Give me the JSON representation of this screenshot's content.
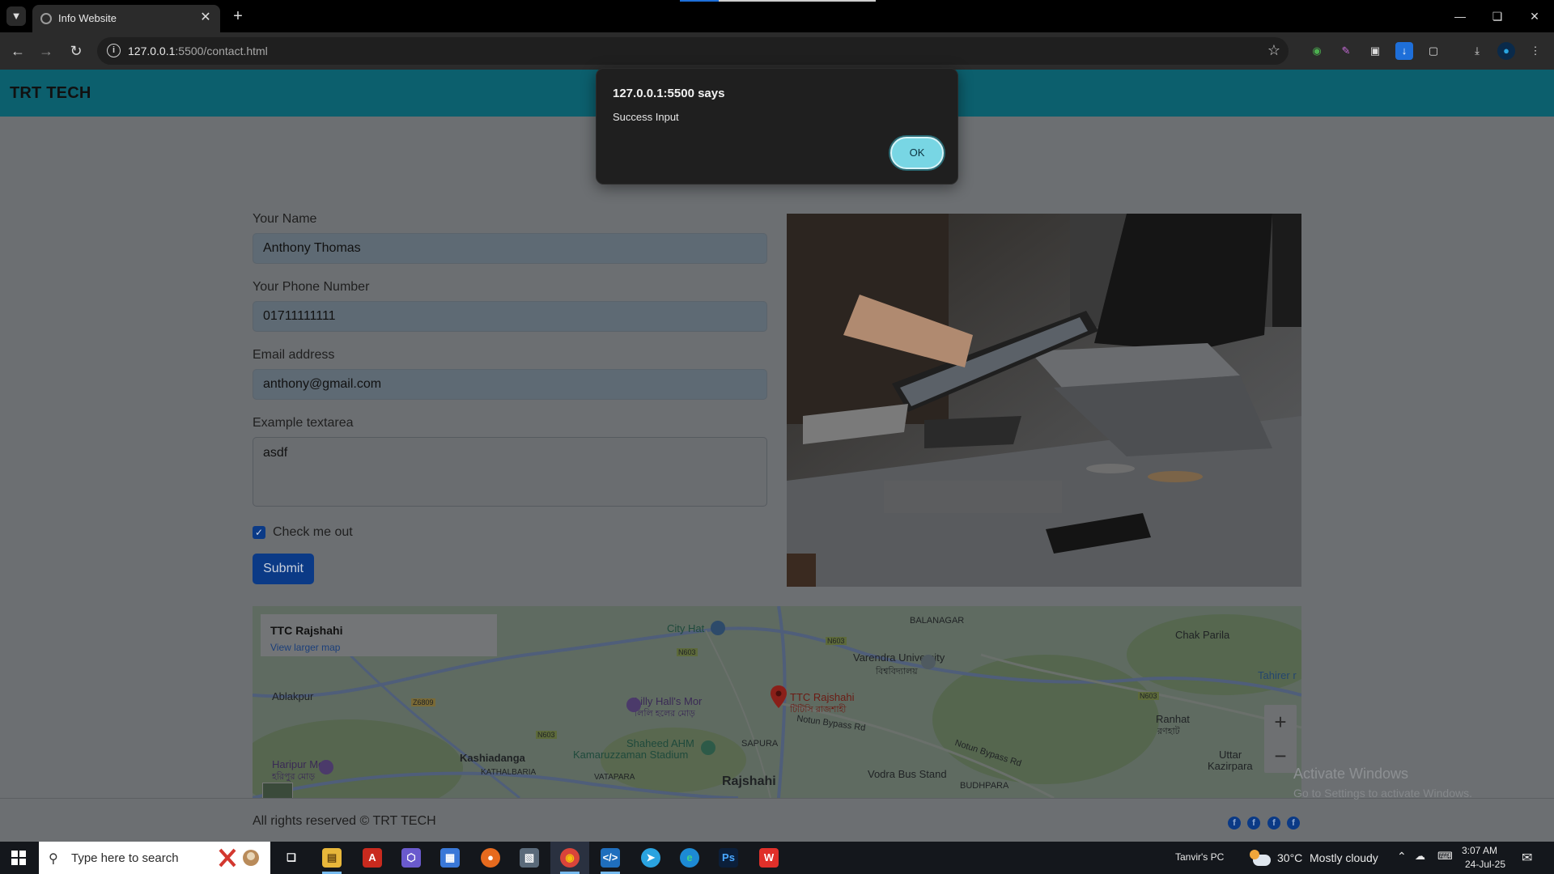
{
  "browser": {
    "tab_title": "Info Website",
    "url_host": "127.0.0.1",
    "url_rest": ":5500/contact.html"
  },
  "site": {
    "brand": "TRT TECH",
    "form": {
      "name_label": "Your Name",
      "name_value": "Anthony Thomas",
      "phone_label": "Your Phone Number",
      "phone_value": "01711111111",
      "email_label": "Email address",
      "email_value": "anthony@gmail.com",
      "textarea_label": "Example textarea",
      "textarea_value": "asdf",
      "checkbox_label": "Check me out",
      "checkbox_checked": true,
      "submit_label": "Submit"
    },
    "map": {
      "place_title": "TTC Rajshahi",
      "larger_map_link": "View larger map",
      "labels": {
        "city_hat": "City Hat",
        "balanagar": "BALANAGAR",
        "chak_parila": "Chak Parila",
        "ablakpur": "Ablakpur",
        "varendra": "Varendra University",
        "varendra_bn": "বিশ্ববিদ্যালয়",
        "tahirer": "Tahirer r",
        "lilly_hall": "Lilly Hall's Mor",
        "lilly_hall_bn": "লিলি হলের মোড়",
        "ttc_pin": "TTC Rajshahi",
        "ttc_pin_bn": "টিটিসি রাজশাহী",
        "notun_bypass_rd": "Notun Bypass Rd",
        "ranhat": "Ranhat",
        "ranhat_bn": "রণহাট",
        "shaheed_ahm": "Shaheed AHM",
        "kamaruzzaman": "Kamaruzzaman Stadium",
        "sapura": "SAPURA",
        "haripur": "Haripur Mor",
        "haripur_bn": "হরিপুর মোড়",
        "kashiadanga": "Kashiadanga",
        "kathalbaria": "KATHALBARIA",
        "vatapara": "VATAPARA",
        "rajshahi": "Rajshahi",
        "vodra": "Vodra Bus Stand",
        "budhpara": "BUDHPARA",
        "notun_bypass_rd2": "Notun Bypass Rd",
        "uttar": "Uttar",
        "kazirpara": "Kazirpara",
        "z6809": "Z6809",
        "n603_a": "N603",
        "n603_b": "N603",
        "n603_c": "N603",
        "n603_d": "N603"
      },
      "zoom_in": "+",
      "zoom_out": "−"
    },
    "footer_text": "All rights reserved © TRT TECH"
  },
  "dialog": {
    "title": "127.0.0.1:5500 says",
    "message": "Success Input",
    "ok_label": "OK"
  },
  "watermark": {
    "title": "Activate Windows",
    "subtitle": "Go to Settings to activate Windows."
  },
  "taskbar": {
    "search_placeholder": "Type here to search",
    "pc_name": "Tanvir's PC",
    "weather_temp": "30°C",
    "weather_desc": "Mostly cloudy",
    "time": "3:07 AM",
    "date": "24-Jul-25"
  }
}
